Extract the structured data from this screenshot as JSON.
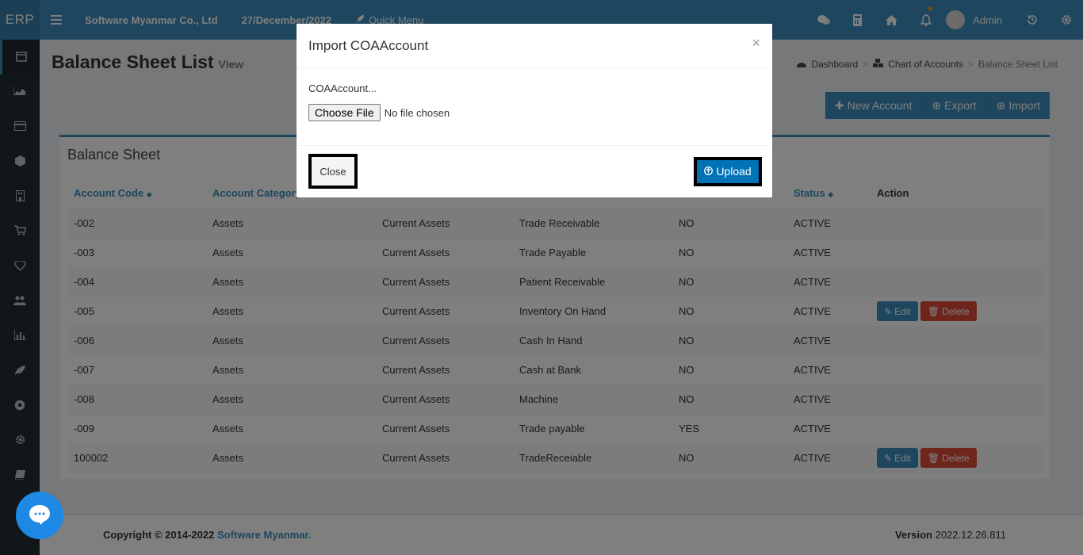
{
  "header": {
    "logo": "ERP",
    "company": "Software Myanmar Co., Ltd",
    "date": "27/December/2022",
    "quick_menu": "Quick Menu",
    "user": "Admin"
  },
  "page": {
    "title": "Balance Sheet List",
    "subtitle": "View",
    "breadcrumb": [
      "Dashboard",
      "Chart of Accounts",
      "Balance Sheet List"
    ]
  },
  "toolbar": {
    "new_account": "New Account",
    "export": "Export",
    "import": "Import"
  },
  "box": {
    "title": "Balance Sheet"
  },
  "table": {
    "headers": [
      "Account Code",
      "Account Category",
      "",
      "",
      "",
      "Status",
      "Action"
    ],
    "rows": [
      {
        "code": "-002",
        "category": "Assets",
        "type": "Current Assets",
        "name": "Trade Receivable",
        "flag": "NO",
        "status": "ACTIVE",
        "actions": false
      },
      {
        "code": "-003",
        "category": "Assets",
        "type": "Current Assets",
        "name": "Trade Payable",
        "flag": "NO",
        "status": "ACTIVE",
        "actions": false
      },
      {
        "code": "-004",
        "category": "Assets",
        "type": "Current Assets",
        "name": "Patient Receivable",
        "flag": "NO",
        "status": "ACTIVE",
        "actions": false
      },
      {
        "code": "-005",
        "category": "Assets",
        "type": "Current Assets",
        "name": "Inventory On Hand",
        "flag": "NO",
        "status": "ACTIVE",
        "actions": true
      },
      {
        "code": "-006",
        "category": "Assets",
        "type": "Current Assets",
        "name": "Cash In Hand",
        "flag": "NO",
        "status": "ACTIVE",
        "actions": false
      },
      {
        "code": "-007",
        "category": "Assets",
        "type": "Current Assets",
        "name": "Cash at Bank",
        "flag": "NO",
        "status": "ACTIVE",
        "actions": false
      },
      {
        "code": "-008",
        "category": "Assets",
        "type": "Current Assets",
        "name": "Machine",
        "flag": "NO",
        "status": "ACTIVE",
        "actions": false
      },
      {
        "code": "-009",
        "category": "Assets",
        "type": "Current Assets",
        "name": "Trade payable",
        "flag": "YES",
        "status": "ACTIVE",
        "actions": false
      },
      {
        "code": "100002",
        "category": "Assets",
        "type": "Current Assets",
        "name": "TradeReceiable",
        "flag": "NO",
        "status": "ACTIVE",
        "actions": true
      }
    ],
    "edit_label": "Edit",
    "delete_label": "Delete"
  },
  "footer": {
    "copyright": "Copyright © 2014-2022",
    "company_link": "Software Myanmar.",
    "version_label": "Version",
    "version": "2022.12.26.811"
  },
  "modal": {
    "title": "Import COAAccount",
    "close_x": "×",
    "field_label": "COAAccount...",
    "choose_file": "Choose File",
    "no_file": "No file chosen",
    "close_button": "Close",
    "upload_button": "Upload"
  },
  "colors": {
    "header": "#3c8dbc",
    "sidebar": "#222d32",
    "primary_button": "#0073b7",
    "danger": "#dd4b39",
    "chat": "#1e88e5"
  }
}
